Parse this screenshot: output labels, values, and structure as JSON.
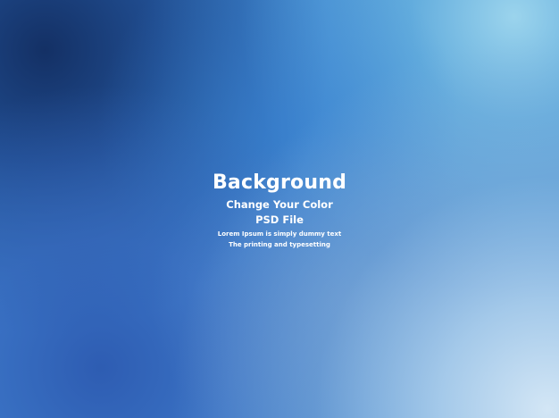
{
  "banner": {
    "title": "Background",
    "subtitle": "Change Your Color",
    "file_type": "PSD File",
    "line_1": "Lorem Ipsum is simply dummy text",
    "line_2": "The printing and typesetting"
  },
  "colors": {
    "deep_navy": "#10295c",
    "mid_blue": "#3f86cf",
    "light_sky": "#a0d8ee",
    "pale_corner": "#d6e8f6",
    "text": "#ffffff"
  }
}
